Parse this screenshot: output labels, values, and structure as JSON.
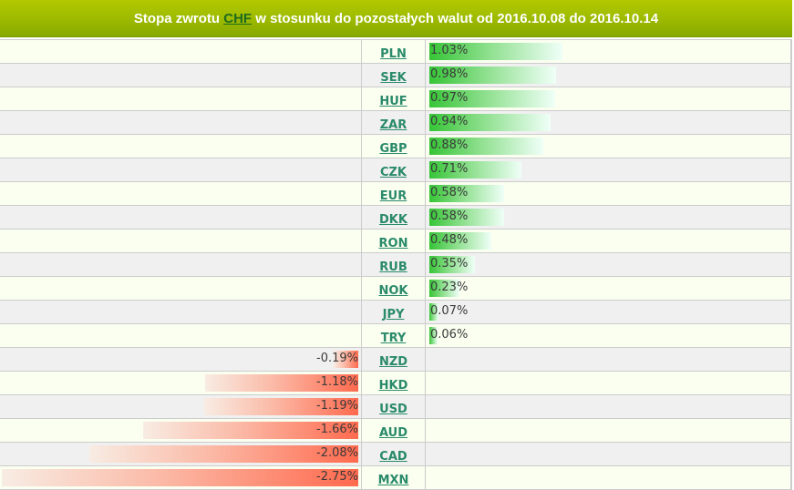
{
  "header": {
    "title_prefix": "Stopa zwrotu ",
    "base_currency": "CHF",
    "title_suffix": " w stosunku do pozostałych walut od 2016.10.08 do 2016.10.14"
  },
  "colors": {
    "header_top": "#b3c900",
    "header_bottom": "#86a900",
    "positive_bar": "#36c436",
    "negative_bar": "#ff6a4e",
    "link": "#2a8a6a",
    "row_odd": "#fafff0",
    "row_even": "#f0f0f0"
  },
  "rows": [
    {
      "code": "PLN",
      "value": 1.03,
      "label": "1.03%"
    },
    {
      "code": "SEK",
      "value": 0.98,
      "label": "0.98%"
    },
    {
      "code": "HUF",
      "value": 0.97,
      "label": "0.97%"
    },
    {
      "code": "ZAR",
      "value": 0.94,
      "label": "0.94%"
    },
    {
      "code": "GBP",
      "value": 0.88,
      "label": "0.88%"
    },
    {
      "code": "CZK",
      "value": 0.71,
      "label": "0.71%"
    },
    {
      "code": "EUR",
      "value": 0.58,
      "label": "0.58%"
    },
    {
      "code": "DKK",
      "value": 0.58,
      "label": "0.58%"
    },
    {
      "code": "RON",
      "value": 0.48,
      "label": "0.48%"
    },
    {
      "code": "RUB",
      "value": 0.35,
      "label": "0.35%"
    },
    {
      "code": "NOK",
      "value": 0.23,
      "label": "0.23%"
    },
    {
      "code": "JPY",
      "value": 0.07,
      "label": "0.07%"
    },
    {
      "code": "TRY",
      "value": 0.06,
      "label": "0.06%"
    },
    {
      "code": "NZD",
      "value": -0.19,
      "label": "-0.19%"
    },
    {
      "code": "HKD",
      "value": -1.18,
      "label": "-1.18%"
    },
    {
      "code": "USD",
      "value": -1.19,
      "label": "-1.19%"
    },
    {
      "code": "AUD",
      "value": -1.66,
      "label": "-1.66%"
    },
    {
      "code": "CAD",
      "value": -2.08,
      "label": "-2.08%"
    },
    {
      "code": "MXN",
      "value": -2.75,
      "label": "-2.75%"
    }
  ],
  "chart_data": {
    "type": "bar",
    "title": "Stopa zwrotu CHF w stosunku do pozostałych walut od 2016.10.08 do 2016.10.14",
    "categories": [
      "PLN",
      "SEK",
      "HUF",
      "ZAR",
      "GBP",
      "CZK",
      "EUR",
      "DKK",
      "RON",
      "RUB",
      "NOK",
      "JPY",
      "TRY",
      "NZD",
      "HKD",
      "USD",
      "AUD",
      "CAD",
      "MXN"
    ],
    "values": [
      1.03,
      0.98,
      0.97,
      0.94,
      0.88,
      0.71,
      0.58,
      0.58,
      0.48,
      0.35,
      0.23,
      0.07,
      0.06,
      -0.19,
      -1.18,
      -1.19,
      -1.66,
      -2.08,
      -2.75
    ],
    "unit": "%",
    "orientation": "horizontal",
    "xlabel": "",
    "ylabel": ""
  }
}
